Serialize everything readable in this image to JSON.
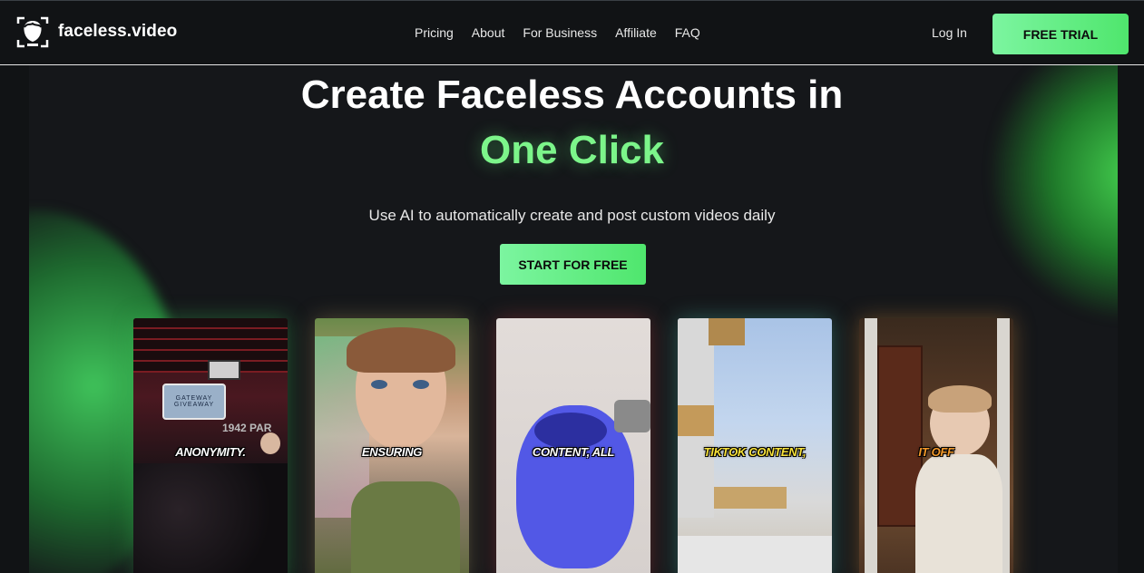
{
  "header": {
    "brand": "faceless.video",
    "nav": [
      "Pricing",
      "About",
      "For Business",
      "Affiliate",
      "FAQ"
    ],
    "login_label": "Log In",
    "trial_label": "FREE TRIAL"
  },
  "hero": {
    "title_line1": "Create Faceless Accounts in",
    "title_line2": "One Click",
    "subtitle": "Use AI to automatically create and post custom videos daily",
    "cta_label": "START FOR FREE"
  },
  "cards": [
    {
      "caption": "ANONYMITY.",
      "sign_text": "GATEWAY GIVEAWAY",
      "bg_text": "1942 PAR"
    },
    {
      "caption": "ENSURING"
    },
    {
      "caption": "CONTENT, ALL"
    },
    {
      "caption": "TIKTOK CONTENT,"
    },
    {
      "caption": "IT OFF"
    }
  ],
  "colors": {
    "accent": "#7cf58a",
    "button": "#5bec7e",
    "background": "#111315"
  }
}
